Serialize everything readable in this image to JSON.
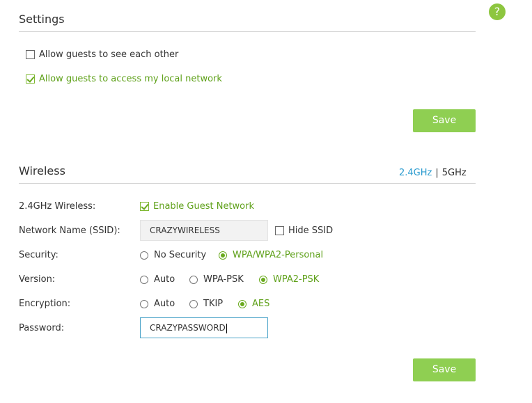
{
  "help_icon_glyph": "?",
  "settings": {
    "title": "Settings",
    "allow_see_each_other": {
      "label": "Allow guests to see each other",
      "checked": false
    },
    "allow_local_network": {
      "label": "Allow guests to access my local network",
      "checked": true
    },
    "save_label": "Save"
  },
  "wireless": {
    "title": "Wireless",
    "bands": {
      "active": "2.4GHz",
      "separator": "|",
      "other": "5GHz"
    },
    "wireless_row": {
      "label": "2.4GHz Wireless:",
      "option_label": "Enable Guest Network",
      "checked": true
    },
    "ssid_row": {
      "label": "Network Name (SSID):",
      "value": "CRAZYWIRELESS",
      "hide_label": "Hide SSID",
      "hide_checked": false
    },
    "security_row": {
      "label": "Security:",
      "options": [
        "No Security",
        "WPA/WPA2-Personal"
      ],
      "selected": "WPA/WPA2-Personal"
    },
    "version_row": {
      "label": "Version:",
      "options": [
        "Auto",
        "WPA-PSK",
        "WPA2-PSK"
      ],
      "selected": "WPA2-PSK"
    },
    "encryption_row": {
      "label": "Encryption:",
      "options": [
        "Auto",
        "TKIP",
        "AES"
      ],
      "selected": "AES"
    },
    "password_row": {
      "label": "Password:",
      "value": "CRAZYPASSWORD"
    },
    "save_label": "Save"
  },
  "colors": {
    "accent_green": "#8fcf52",
    "selected_text_green": "#5fa11a",
    "band_active_blue": "#2a9bcf",
    "field_focus_border": "#4aa3c9"
  }
}
